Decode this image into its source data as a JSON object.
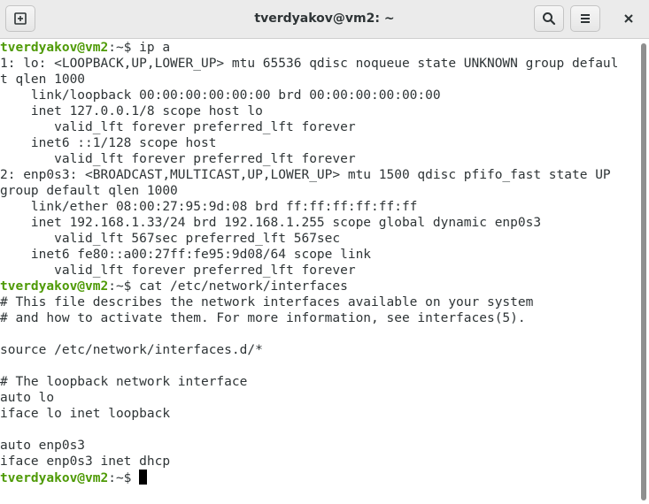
{
  "window": {
    "title": "tverdyakov@vm2: ~"
  },
  "toolbar": {
    "new_tab_icon": "new-tab-icon",
    "search_icon": "search-icon",
    "menu_icon": "hamburger-menu-icon",
    "close_icon": "close-icon"
  },
  "prompt": {
    "user_host": "tverdyakov@vm2",
    "path_symbol": ":~$ "
  },
  "terminal": {
    "lines": [
      {
        "type": "prompt",
        "command": "ip a"
      },
      {
        "type": "text",
        "text": "1: lo: <LOOPBACK,UP,LOWER_UP> mtu 65536 qdisc noqueue state UNKNOWN group defaul"
      },
      {
        "type": "text",
        "text": "t qlen 1000"
      },
      {
        "type": "text",
        "text": "    link/loopback 00:00:00:00:00:00 brd 00:00:00:00:00:00"
      },
      {
        "type": "text",
        "text": "    inet 127.0.0.1/8 scope host lo"
      },
      {
        "type": "text",
        "text": "       valid_lft forever preferred_lft forever"
      },
      {
        "type": "text",
        "text": "    inet6 ::1/128 scope host"
      },
      {
        "type": "text",
        "text": "       valid_lft forever preferred_lft forever"
      },
      {
        "type": "text",
        "text": "2: enp0s3: <BROADCAST,MULTICAST,UP,LOWER_UP> mtu 1500 qdisc pfifo_fast state UP"
      },
      {
        "type": "text",
        "text": "group default qlen 1000"
      },
      {
        "type": "text",
        "text": "    link/ether 08:00:27:95:9d:08 brd ff:ff:ff:ff:ff:ff"
      },
      {
        "type": "text",
        "text": "    inet 192.168.1.33/24 brd 192.168.1.255 scope global dynamic enp0s3"
      },
      {
        "type": "text",
        "text": "       valid_lft 567sec preferred_lft 567sec"
      },
      {
        "type": "text",
        "text": "    inet6 fe80::a00:27ff:fe95:9d08/64 scope link"
      },
      {
        "type": "text",
        "text": "       valid_lft forever preferred_lft forever"
      },
      {
        "type": "prompt",
        "command": "cat /etc/network/interfaces"
      },
      {
        "type": "text",
        "text": "# This file describes the network interfaces available on your system"
      },
      {
        "type": "text",
        "text": "# and how to activate them. For more information, see interfaces(5)."
      },
      {
        "type": "text",
        "text": ""
      },
      {
        "type": "text",
        "text": "source /etc/network/interfaces.d/*"
      },
      {
        "type": "text",
        "text": ""
      },
      {
        "type": "text",
        "text": "# The loopback network interface"
      },
      {
        "type": "text",
        "text": "auto lo"
      },
      {
        "type": "text",
        "text": "iface lo inet loopback"
      },
      {
        "type": "text",
        "text": ""
      },
      {
        "type": "text",
        "text": "auto enp0s3"
      },
      {
        "type": "text",
        "text": "iface enp0s3 inet dhcp"
      },
      {
        "type": "prompt",
        "command": "",
        "cursor": true
      }
    ]
  },
  "colors": {
    "prompt_user": "#4e9a06",
    "text": "#2e3436",
    "background": "#ffffff",
    "titlebar": "#ebebeb"
  }
}
